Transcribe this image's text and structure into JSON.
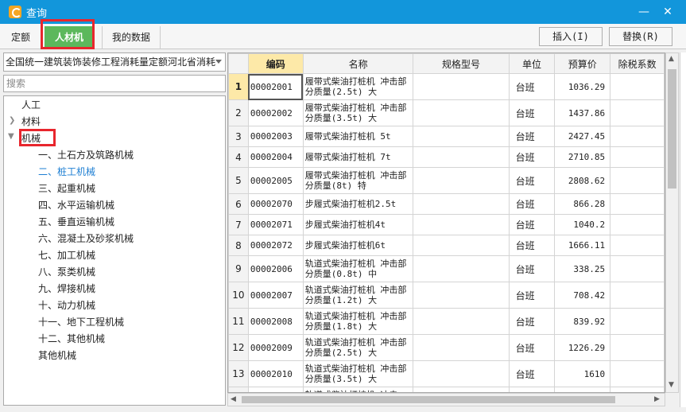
{
  "window": {
    "title": "查询"
  },
  "tabs": [
    {
      "label": "定额"
    },
    {
      "label": "人材机"
    },
    {
      "label": "我的数据"
    }
  ],
  "toolbar": {
    "insert_label": "插入(I)",
    "replace_label": "替换(R)"
  },
  "library": {
    "selected": "全国统一建筑装饰装修工程消耗量定额河北省消耗"
  },
  "search": {
    "placeholder": "搜索"
  },
  "tree": {
    "items": [
      {
        "label": "人工"
      },
      {
        "label": "材料"
      },
      {
        "label": "机械"
      },
      {
        "label": "一、土石方及筑路机械"
      },
      {
        "label": "二、桩工机械"
      },
      {
        "label": "三、起重机械"
      },
      {
        "label": "四、水平运输机械"
      },
      {
        "label": "五、垂直运输机械"
      },
      {
        "label": "六、混凝土及砂浆机械"
      },
      {
        "label": "七、加工机械"
      },
      {
        "label": "八、泵类机械"
      },
      {
        "label": "九、焊接机械"
      },
      {
        "label": "十、动力机械"
      },
      {
        "label": "十一、地下工程机械"
      },
      {
        "label": "十二、其他机械"
      },
      {
        "label": "其他机械"
      }
    ]
  },
  "table": {
    "headers": {
      "code": "编码",
      "name": "名称",
      "spec": "规格型号",
      "unit": "单位",
      "price": "预算价",
      "tax": "除税系数"
    },
    "rows": [
      {
        "num": "1",
        "code": "00002001",
        "name": "履带式柴油打桩机 冲击部分质量(2.5t) 大",
        "unit": "台班",
        "price": "1036.29"
      },
      {
        "num": "2",
        "code": "00002002",
        "name": "履带式柴油打桩机 冲击部分质量(3.5t) 大",
        "unit": "台班",
        "price": "1437.86"
      },
      {
        "num": "3",
        "code": "00002003",
        "name": "履带式柴油打桩机 5t",
        "unit": "台班",
        "price": "2427.45"
      },
      {
        "num": "4",
        "code": "00002004",
        "name": "履带式柴油打桩机 7t",
        "unit": "台班",
        "price": "2710.85"
      },
      {
        "num": "5",
        "code": "00002005",
        "name": "履带式柴油打桩机 冲击部分质量(8t) 特",
        "unit": "台班",
        "price": "2808.62"
      },
      {
        "num": "6",
        "code": "00002070",
        "name": "步履式柴油打桩机2.5t",
        "unit": "台班",
        "price": "866.28"
      },
      {
        "num": "7",
        "code": "00002071",
        "name": "步履式柴油打桩机4t",
        "unit": "台班",
        "price": "1040.2"
      },
      {
        "num": "8",
        "code": "00002072",
        "name": "步履式柴油打桩机6t",
        "unit": "台班",
        "price": "1666.11"
      },
      {
        "num": "9",
        "code": "00002006",
        "name": "轨道式柴油打桩机 冲击部分质量(0.8t) 中",
        "unit": "台班",
        "price": "338.25"
      },
      {
        "num": "10",
        "code": "00002007",
        "name": "轨道式柴油打桩机 冲击部分质量(1.2t) 大",
        "unit": "台班",
        "price": "708.42"
      },
      {
        "num": "11",
        "code": "00002008",
        "name": "轨道式柴油打桩机 冲击部分质量(1.8t) 大",
        "unit": "台班",
        "price": "839.92"
      },
      {
        "num": "12",
        "code": "00002009",
        "name": "轨道式柴油打桩机 冲击部分质量(2.5t) 大",
        "unit": "台班",
        "price": "1226.29"
      },
      {
        "num": "13",
        "code": "00002010",
        "name": "轨道式柴油打桩机 冲击部分质量(3.5t) 大",
        "unit": "台班",
        "price": "1610"
      },
      {
        "num": "",
        "code": "",
        "name": "轨道式柴油打桩机 冲击",
        "unit": "",
        "price": ""
      }
    ]
  },
  "colors": {
    "titlebar": "#1296db",
    "active_tab": "#5cb85c",
    "highlight_box": "#e8262d",
    "active_header": "#fde9a8",
    "selected_tree_item": "#1e7fd3"
  }
}
